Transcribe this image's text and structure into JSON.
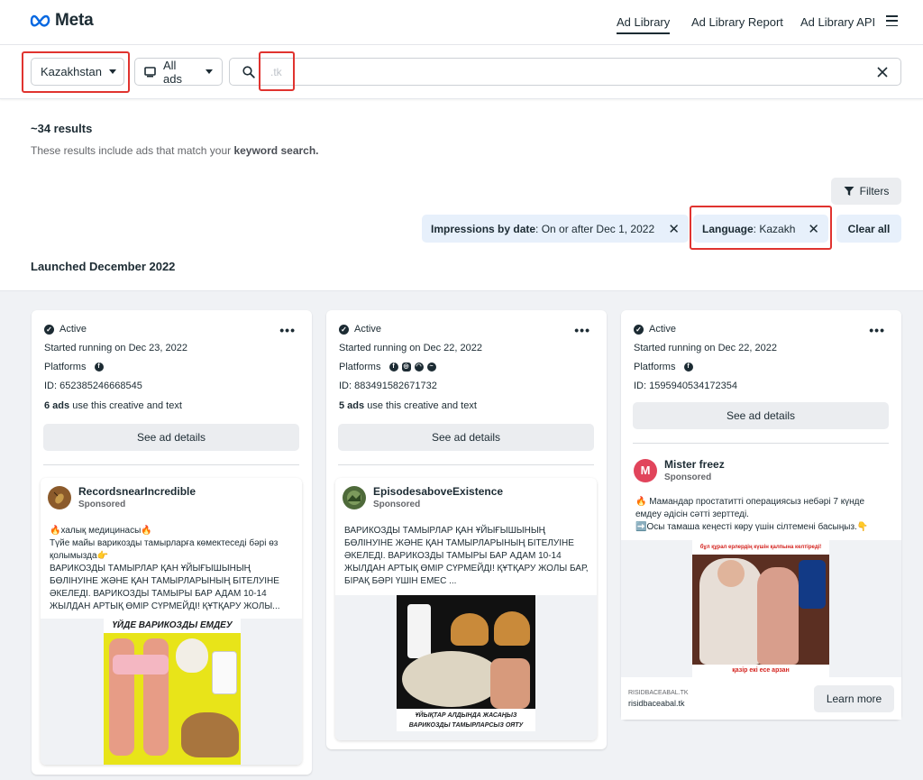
{
  "nav": {
    "brand": "Meta",
    "links": [
      "Ad Library",
      "Ad Library Report",
      "Ad Library API"
    ]
  },
  "search": {
    "country": "Kazakhstan",
    "ad_type": "All ads",
    "query": ".tk"
  },
  "results": {
    "count": "~34 results",
    "note_prefix": "These results include ads that match your ",
    "note_bold": "keyword search."
  },
  "filters": {
    "button_label": "Filters",
    "chip_impressions_key": "Impressions by date",
    "chip_impressions_value": ": On or after Dec 1, 2022",
    "chip_language_key": "Language",
    "chip_language_value": ": Kazakh",
    "clear_all": "Clear all"
  },
  "section_title": "Launched December 2022",
  "cards": [
    {
      "status": "Active",
      "started": "Started running on Dec 23, 2022",
      "platforms_label": "Platforms",
      "ad_id": "ID: 652385246668545",
      "uses_count": "6 ads",
      "uses_text": " use this creative and text",
      "details_label": "See ad details",
      "page_name": "RecordsnearIncredible",
      "sponsored": "Sponsored",
      "body": "🔥халық медицинасы🔥\nТүйе майы варикозды тамырларға көмектеседі бәрі өз қолымызда👉\nВАРИКОЗДЫ ТАМЫРЛАР ҚАН ҰЙЫҒЫШЫНЫҢ БӨЛІНУІНЕ ЖӘНЕ ҚАН ТАМЫРЛАРЫНЫҢ БІТЕЛУІНЕ ӘКЕЛЕДІ. ВАРИКОЗДЫ ТАМЫРЫ БАР АДАМ 10-14 ЖЫЛДАН АРТЫҚ ӨМІР СҮРМЕЙДІ! ҚҰТҚАРУ ЖОЛЫ...",
      "creative_caption": "ҮЙДЕ ВАРИКОЗДЫ ЕМДЕУ"
    },
    {
      "status": "Active",
      "started": "Started running on Dec 22, 2022",
      "platforms_label": "Platforms",
      "ad_id": "ID: 883491582671732",
      "uses_count": "5 ads",
      "uses_text": " use this creative and text",
      "details_label": "See ad details",
      "page_name": "EpisodesaboveExistence",
      "sponsored": "Sponsored",
      "body": "ВАРИКОЗДЫ ТАМЫРЛАР ҚАН ҰЙЫҒЫШЫНЫҢ БӨЛІНУІНЕ ЖӘНЕ ҚАН ТАМЫРЛАРЫНЫҢ БІТЕЛУІНЕ ӘКЕЛЕДІ. ВАРИКОЗДЫ ТАМЫРЫ БАР АДАМ 10-14 ЖЫЛДАН АРТЫҚ ӨМІР СҮРМЕЙДІ! ҚҰТҚАРУ ЖОЛЫ БАР, БІРАҚ БӘРІ ҮШІН ЕМЕС ...",
      "creative_caption_1": "ҰЙЫҚТАР АЛДЫНДА ЖАСАҢЫЗ",
      "creative_caption_2": "ВАРИКОЗДЫ ТАМЫРЛАРСЫЗ ОЯТУ"
    },
    {
      "status": "Active",
      "started": "Started running on Dec 22, 2022",
      "platforms_label": "Platforms",
      "ad_id": "ID: 1595940534172354",
      "details_label": "See ad details",
      "page_name": "Mister freez",
      "avatar_letter": "M",
      "sponsored": "Sponsored",
      "body": "🔥 Мамандар простатитті операциясыз небәрі 7 күнде емдеу әдісін сәтті зерттеді.\n➡️Осы тамаша кеңесті көру үшін сілтемені басыңыз.👇",
      "creative_caption_top": "бұл құрал ерлердің күшін қалпына келтіреді!",
      "creative_caption_bottom": "қазір екі есе арзан",
      "cta_domain_upper": "RISIDBACEABAL.TK",
      "cta_domain": "risidbaceabal.tk",
      "cta_label": "Learn more"
    }
  ],
  "colors": {
    "red_highlight": "#e0332f",
    "chip_bg": "#e7f0fb",
    "content_bg": "#f0f2f5",
    "meta_blue": "#0668e1"
  }
}
